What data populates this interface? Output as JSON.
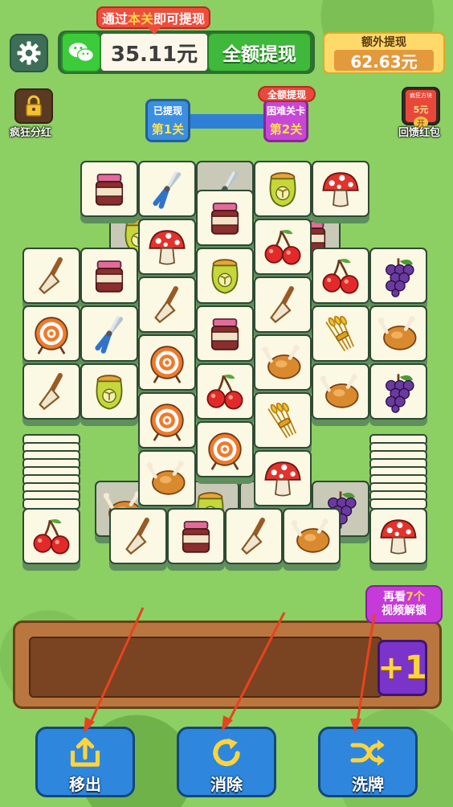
{
  "header": {
    "tip_prefix": "通过",
    "tip_highlight": "本关",
    "tip_suffix": "即可提现",
    "balance": "35.11元",
    "withdraw_all_label": "全额提现",
    "extra_label": "额外提现",
    "extra_amount": "62.63元"
  },
  "side": {
    "left_label": "疯狂分红",
    "right_label": "回馈红包",
    "right_card_title": "疯狂方块",
    "right_card_amount": "5元",
    "right_card_open": "开"
  },
  "progress": {
    "level1_small": "已提现",
    "level1_big": "第1关",
    "level2_tag": "全额提现",
    "level2_small": "困难关卡",
    "level2_big": "第2关"
  },
  "board": {
    "tiles": [
      {
        "icon": "jam-jar",
        "col": 0,
        "row": 0,
        "top": true
      },
      {
        "icon": "pruning-shears",
        "col": 1,
        "row": 0,
        "top": true
      },
      {
        "icon": "pruning-shears",
        "col": 2,
        "row": 0,
        "top": false
      },
      {
        "icon": "seed-bag",
        "col": 3,
        "row": 0,
        "top": true
      },
      {
        "icon": "mushroom",
        "col": 4,
        "row": 0,
        "top": true
      }
    ]
  },
  "slot": {
    "unlock_prefix": "再看",
    "unlock_count": "7个",
    "unlock_suffix": "视频解锁",
    "plus_one": "+1"
  },
  "tools": [
    {
      "label": "移出",
      "icon": "move-out-icon"
    },
    {
      "label": "消除",
      "icon": "refresh-icon"
    },
    {
      "label": "洗牌",
      "icon": "shuffle-icon"
    }
  ],
  "colors": {
    "grass": "#8ccf63",
    "button_blue": "#2e87dd",
    "tile_face": "#fbf8e4",
    "level1": "#3c8ee0",
    "level2": "#c748d6"
  }
}
